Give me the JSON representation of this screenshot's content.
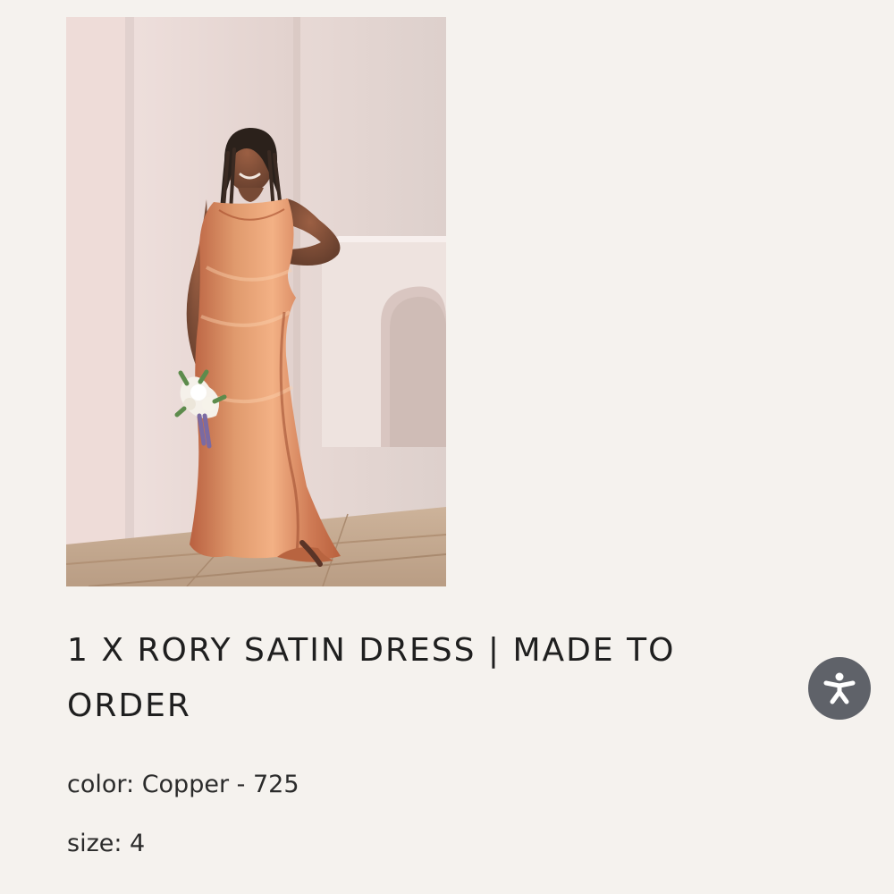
{
  "product": {
    "image_alt": "Model wearing copper satin dress holding flowers",
    "title": "1 X RORY SATIN DRESS | MADE TO ORDER",
    "color_text": "color: Copper - 725",
    "size_text": "size: 4"
  },
  "accessibility": {
    "icon": "accessibility-person-icon",
    "label": "Accessibility"
  },
  "colors": {
    "background": "#f5f2ee",
    "dress": "#d88a60",
    "accessibility_button": "#5f6269"
  }
}
